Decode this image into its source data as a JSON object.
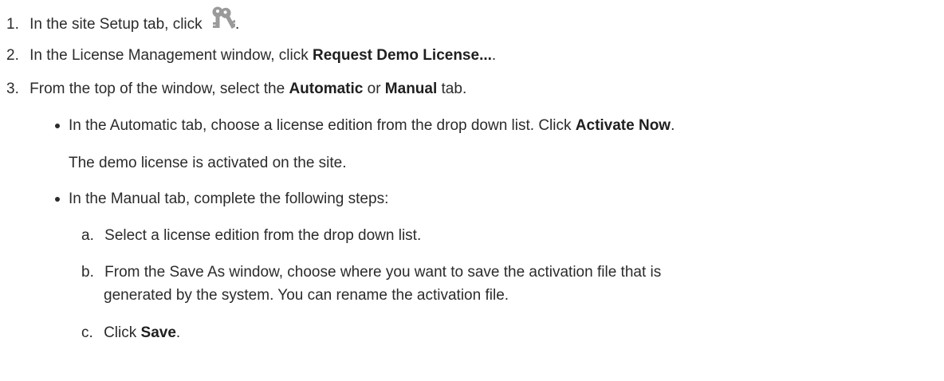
{
  "steps": [
    {
      "number": "1.",
      "text_before": "In the site Setup tab, click",
      "icon": "license-keys-icon",
      "text_after": "."
    },
    {
      "number": "2.",
      "text_before": "In the License Management window, click ",
      "bold": "Request Demo License...",
      "text_after": "."
    },
    {
      "number": "3.",
      "text_before": "From the top of the window, select the ",
      "bold1": "Automatic",
      "text_mid": " or ",
      "bold2": "Manual",
      "text_after": " tab."
    }
  ],
  "bullets": [
    {
      "text_before": "In the Automatic tab, choose a license edition from the drop down list. Click ",
      "bold": "Activate Now",
      "text_after": ".",
      "note": "The demo license is activated on the site."
    },
    {
      "text": "In the Manual tab, complete the following steps:"
    }
  ],
  "substeps": [
    {
      "letter": "a.",
      "text": "Select a license edition from the drop down list."
    },
    {
      "letter": "b.",
      "line1": "From the Save As window, choose where you want to save the activation file that is",
      "line2": "generated by the system. You can rename the activation file."
    },
    {
      "letter": "c.",
      "text_before": "Click ",
      "bold": "Save",
      "text_after": "."
    }
  ],
  "colors": {
    "text": "#2b2b2b",
    "icon": "#9a9a9a"
  }
}
